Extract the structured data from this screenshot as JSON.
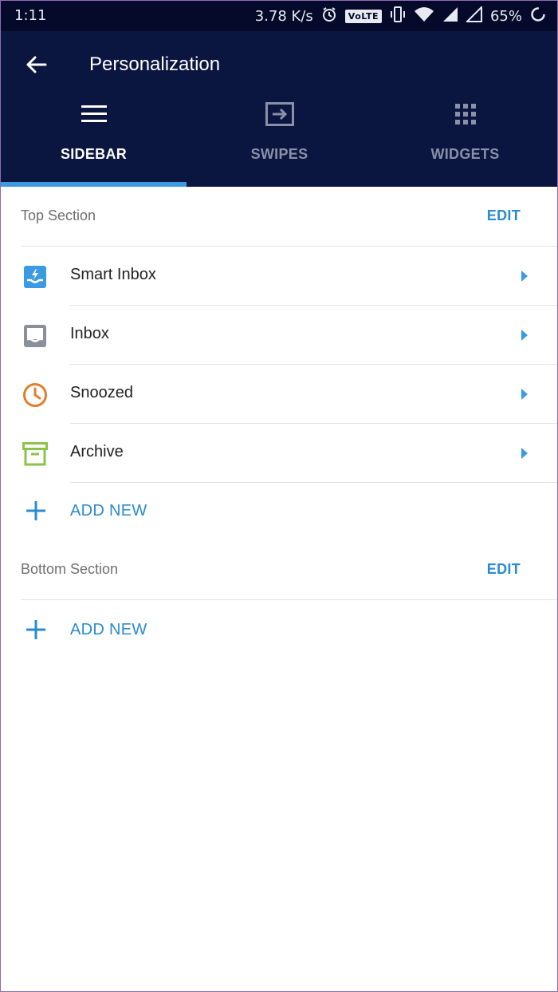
{
  "status_bar": {
    "time": "1:11",
    "net_speed": "3.78 K/s",
    "volte": "VoLTE",
    "battery": "65%"
  },
  "app_bar": {
    "title": "Personalization",
    "back_icon": "arrow-left-icon"
  },
  "tabs": [
    {
      "label": "SIDEBAR",
      "icon": "menu-icon",
      "active": true
    },
    {
      "label": "SWIPES",
      "icon": "swipe-icon",
      "active": false
    },
    {
      "label": "WIDGETS",
      "icon": "grid-icon",
      "active": false
    }
  ],
  "top_section": {
    "title": "Top Section",
    "edit_label": "EDIT",
    "items": [
      {
        "label": "Smart Inbox",
        "icon": "smart-inbox-icon",
        "color": "#3b9ae1"
      },
      {
        "label": "Inbox",
        "icon": "inbox-icon",
        "color": "#8a8f99"
      },
      {
        "label": "Snoozed",
        "icon": "clock-icon",
        "color": "#e07e2e"
      },
      {
        "label": "Archive",
        "icon": "archive-icon",
        "color": "#8bc34a"
      }
    ],
    "add_label": "ADD NEW"
  },
  "bottom_section": {
    "title": "Bottom Section",
    "edit_label": "EDIT",
    "add_label": "ADD NEW"
  },
  "colors": {
    "status_bar_bg": "#05092a",
    "app_bar_bg": "#0b1640",
    "accent": "#2a8bd0",
    "tab_indicator": "#3b9ae1"
  }
}
